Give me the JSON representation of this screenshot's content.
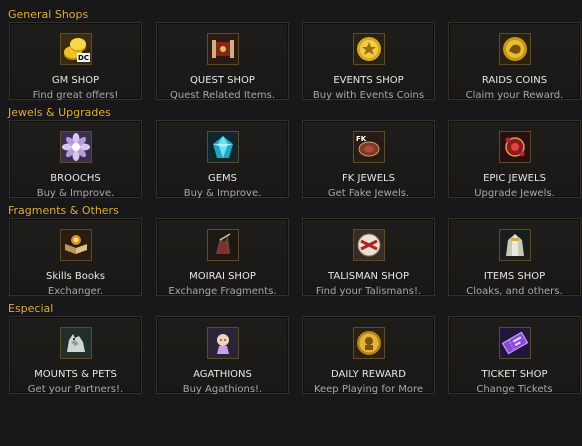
{
  "sections": [
    {
      "title": "General Shops",
      "tiles": [
        {
          "name": "GM SHOP",
          "desc": "Find great offers!",
          "icon": "gm-coins-icon"
        },
        {
          "name": "QUEST SHOP",
          "desc": "Quest Related Items.",
          "icon": "quest-scroll-icon"
        },
        {
          "name": "EVENTS SHOP",
          "desc": "Buy with Events Coins",
          "icon": "event-coin-icon"
        },
        {
          "name": "RAIDS COINS",
          "desc": "Claim your Reward.",
          "icon": "raid-coin-icon"
        }
      ]
    },
    {
      "title": "Jewels & Upgrades",
      "tiles": [
        {
          "name": "BROOCHS",
          "desc": "Buy & Improve.",
          "icon": "brooch-icon"
        },
        {
          "name": "GEMS",
          "desc": "Buy & Improve.",
          "icon": "gem-icon"
        },
        {
          "name": "FK JEWELS",
          "desc": "Get Fake Jewels.",
          "icon": "fake-jewel-icon",
          "badge": "FK"
        },
        {
          "name": "EPIC JEWELS",
          "desc": "Upgrade Jewels.",
          "icon": "epic-jewel-icon"
        }
      ]
    },
    {
      "title": "Fragments & Others",
      "tiles": [
        {
          "name": "Skills Books",
          "desc": "Exchanger.",
          "icon": "spellbook-icon"
        },
        {
          "name": "MOIRAI SHOP",
          "desc": "Exchange Fragments.",
          "icon": "moirai-armor-icon"
        },
        {
          "name": "TALISMAN SHOP",
          "desc": "Find your Talismans!.",
          "icon": "talisman-icon"
        },
        {
          "name": "ITEMS SHOP",
          "desc": "Cloaks, and others.",
          "icon": "cloak-icon"
        }
      ]
    },
    {
      "title": "Especial",
      "tiles": [
        {
          "name": "MOUNTS & PETS",
          "desc": "Get your Partners!.",
          "icon": "mount-wolf-icon"
        },
        {
          "name": "AGATHIONS",
          "desc": "Buy Agathions!.",
          "icon": "agathion-icon"
        },
        {
          "name": "DAILY REWARD",
          "desc": "Keep Playing for More",
          "icon": "daily-reward-coin-icon"
        },
        {
          "name": "TICKET SHOP",
          "desc": "Change Tickets",
          "icon": "ticket-icon"
        }
      ]
    }
  ]
}
